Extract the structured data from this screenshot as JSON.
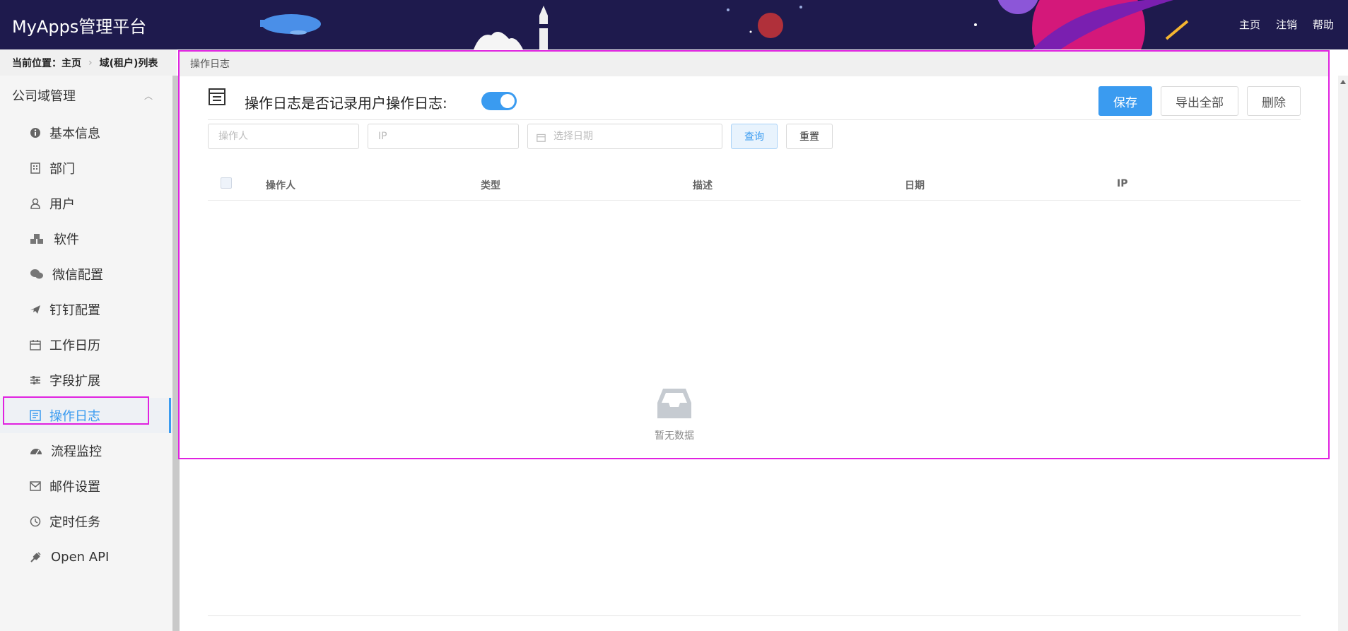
{
  "header": {
    "brand": "MyApps管理平台",
    "nav": [
      "主页",
      "注销",
      "帮助"
    ]
  },
  "breadcrumb": {
    "label": "当前位置：",
    "items": [
      "主页",
      "域(租户)列表"
    ]
  },
  "sidebar": {
    "group": "公司域管理",
    "items": [
      {
        "label": "基本信息",
        "icon": "info-icon"
      },
      {
        "label": "部门",
        "icon": "building-icon"
      },
      {
        "label": "用户",
        "icon": "user-icon"
      },
      {
        "label": "软件",
        "icon": "cubes-icon"
      },
      {
        "label": "微信配置",
        "icon": "wechat-icon"
      },
      {
        "label": "钉钉配置",
        "icon": "plane-icon"
      },
      {
        "label": "工作日历",
        "icon": "calendar-icon"
      },
      {
        "label": "字段扩展",
        "icon": "sliders-icon"
      },
      {
        "label": "操作日志",
        "icon": "log-icon",
        "active": true
      },
      {
        "label": "流程监控",
        "icon": "dashboard-icon"
      },
      {
        "label": "邮件设置",
        "icon": "mail-icon"
      },
      {
        "label": "定时任务",
        "icon": "clock-icon"
      },
      {
        "label": "Open API",
        "icon": "plug-icon"
      }
    ]
  },
  "tab": {
    "label": "操作日志"
  },
  "main": {
    "title": "操作日志是否记录用户操作日志:",
    "switch_on": true,
    "actions": {
      "save": "保存",
      "export": "导出全部",
      "delete": "删除"
    },
    "filters": {
      "operator_placeholder": "操作人",
      "ip_placeholder": "IP",
      "date_placeholder": "选择日期",
      "query": "查询",
      "reset": "重置"
    },
    "table": {
      "columns": [
        "操作人",
        "类型",
        "描述",
        "日期",
        "IP"
      ],
      "rows": []
    },
    "empty_text": "暂无数据"
  },
  "colors": {
    "accent": "#3a9bf0",
    "header_bg": "#1e1a4d",
    "highlight": "#e022e0"
  }
}
